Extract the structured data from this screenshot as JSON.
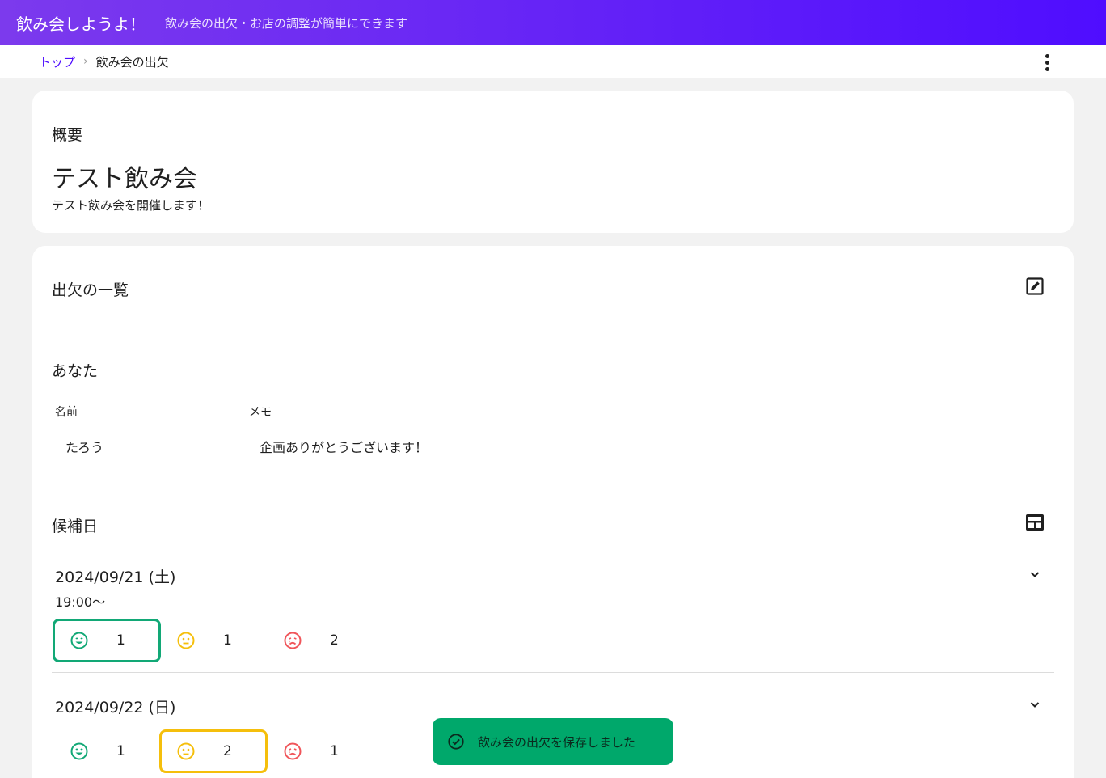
{
  "app": {
    "title": "飲み会しようよ！",
    "subtitle": "飲み会の出欠・お店の調整が簡単にできます"
  },
  "breadcrumb": {
    "home": "トップ",
    "separator": "›",
    "current": "飲み会の出欠"
  },
  "overview": {
    "label": "概要",
    "title": "テスト飲み会",
    "description": "テスト飲み会を開催します！"
  },
  "attendance": {
    "label": "出欠の一覧",
    "you": {
      "label": "あなた",
      "name_label": "名前",
      "memo_label": "メモ",
      "name_value": "たろう",
      "memo_value": "企画ありがとうございます！"
    },
    "candidates": {
      "label": "候補日",
      "dates": [
        {
          "date": "2024/09/21 (土)",
          "time": "19:00～",
          "ok": "1",
          "maybe": "1",
          "ng": "2",
          "selected": "ok"
        },
        {
          "date": "2024/09/22 (日)",
          "time": "",
          "ok": "1",
          "maybe": "2",
          "ng": "1",
          "selected": "maybe"
        }
      ]
    }
  },
  "toast": {
    "message": "飲み会の出欠を保存しました"
  },
  "colors": {
    "brand": "#4f0dff",
    "ok": "#12a876",
    "maybe": "#f5bf0c",
    "ng": "#f0555a",
    "toast": "#00a86b"
  },
  "icons": {
    "more": "more-vert-icon",
    "edit": "edit-square-icon",
    "table": "table-view-icon",
    "expand": "chevron-down-icon",
    "ok": "smile-face-icon",
    "maybe": "neutral-face-icon",
    "ng": "sad-face-icon",
    "toast": "check-circle-icon"
  }
}
